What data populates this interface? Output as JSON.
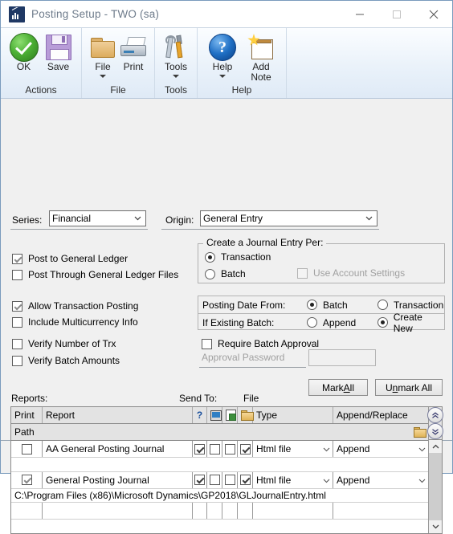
{
  "window": {
    "title": "Posting Setup  -  TWO (sa)",
    "icon": "chart-icon",
    "minimize_label": "Minimize",
    "maximize_label": "Maximize",
    "close_label": "Close"
  },
  "ribbon": {
    "groups": [
      {
        "label": "Actions",
        "items": [
          {
            "label": "OK",
            "icon": "green-check-icon",
            "has_caret": false
          },
          {
            "label": "Save",
            "icon": "floppy-disk-icon",
            "has_caret": false
          }
        ]
      },
      {
        "label": "File",
        "items": [
          {
            "label": "File",
            "icon": "folder-icon",
            "has_caret": true
          },
          {
            "label": "Print",
            "icon": "printer-icon",
            "has_caret": false
          }
        ]
      },
      {
        "label": "Tools",
        "items": [
          {
            "label": "Tools",
            "icon": "wrench-screwdriver-icon",
            "has_caret": true
          }
        ]
      },
      {
        "label": "Help",
        "items": [
          {
            "label": "Help",
            "icon": "blue-question-icon",
            "has_caret": true
          },
          {
            "label": "Add Note",
            "icon": "add-note-icon",
            "has_caret": false
          }
        ]
      }
    ]
  },
  "form": {
    "series_label": "Series:",
    "series_value": "Financial",
    "origin_label": "Origin:",
    "origin_value": "General Entry",
    "post_to_gl_label": "Post to General Ledger",
    "post_to_gl_checked": true,
    "post_through_gl_label": "Post Through General Ledger Files",
    "post_through_gl_checked": false,
    "allow_trx_posting_label": "Allow Transaction Posting",
    "allow_trx_posting_checked": true,
    "include_multicurrency_label": "Include Multicurrency Info",
    "include_multicurrency_checked": false,
    "verify_number_trx_label": "Verify Number of Trx",
    "verify_number_trx_checked": false,
    "verify_batch_amounts_label": "Verify Batch Amounts",
    "verify_batch_amounts_checked": false,
    "journal_group_title": "Create a Journal Entry Per:",
    "journal_transaction_label": "Transaction",
    "journal_batch_label": "Batch",
    "journal_selected": "Transaction",
    "use_account_settings_label": "Use Account Settings",
    "use_account_settings_checked": false,
    "use_account_settings_disabled": true,
    "posting_date_from_label": "Posting Date From:",
    "posting_date_batch_label": "Batch",
    "posting_date_transaction_label": "Transaction",
    "posting_date_selected": "Batch",
    "if_existing_batch_label": "If Existing Batch:",
    "if_existing_append_label": "Append",
    "if_existing_create_new_label": "Create New",
    "if_existing_selected": "Create New",
    "require_batch_approval_label": "Require Batch Approval",
    "require_batch_approval_checked": false,
    "approval_password_label": "Approval Password",
    "approval_password_value": "",
    "mark_all_label_pre": "Mark ",
    "mark_all_label_key": "A",
    "mark_all_label_post": "ll",
    "unmark_all_label_pre": "U",
    "unmark_all_label_key": "n",
    "unmark_all_label_post": "mark All"
  },
  "reports": {
    "reports_label": "Reports:",
    "send_to_label": "Send To:",
    "file_label": "File",
    "headers": {
      "print": "Print",
      "report": "Report",
      "question": "?",
      "screen_icon": "monitor-icon",
      "printer_icon": "document-printer-icon",
      "file_icon": "folder-icon",
      "type": "Type",
      "append_replace": "Append/Replace",
      "path": "Path"
    },
    "rows": [
      {
        "print": false,
        "report": "AA General Posting Journal",
        "to_screen": true,
        "to_printer": false,
        "to_other": false,
        "to_file": true,
        "type": "Html file",
        "append_replace": "Append",
        "path": ""
      },
      {
        "print": true,
        "report": "General Posting Journal",
        "to_screen": true,
        "to_printer": false,
        "to_other": false,
        "to_file": true,
        "type": "Html file",
        "append_replace": "Append",
        "path": "C:\\Program Files (x86)\\Microsoft Dynamics\\GP2018\\GLJournalEntry.html"
      },
      {
        "print": false,
        "report": "",
        "to_screen": false,
        "to_printer": false,
        "to_other": false,
        "to_file": false,
        "type": "",
        "append_replace": "",
        "path": ""
      }
    ]
  },
  "colors": {
    "title_text": "#6e7b8b",
    "ribbon_top": "#fbfdff",
    "ribbon_bottom": "#dfeaf6",
    "window_border": "#7a9bbd",
    "dialog_bg": "#f0f0f0",
    "grid_header_bg": "#e3e3e3",
    "ok_green": "#4cb035",
    "help_blue": "#1f6fc4",
    "folder_orange": "#dcac5e"
  }
}
